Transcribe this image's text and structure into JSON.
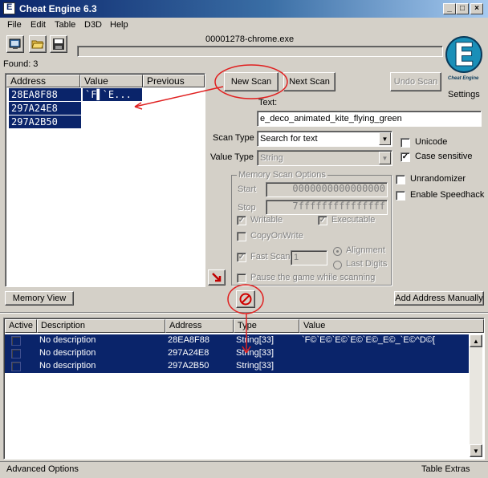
{
  "window": {
    "title": "Cheat Engine 6.3"
  },
  "menu": [
    "File",
    "Edit",
    "Table",
    "D3D",
    "Help"
  ],
  "process": {
    "name": "00001278-chrome.exe"
  },
  "found": {
    "label": "Found: 3"
  },
  "scan_results": {
    "columns": [
      "Address",
      "Value",
      "Previous"
    ],
    "rows": [
      {
        "address": "28EA8F88",
        "value": "`F▌`E..."
      },
      {
        "address": "297A24E8",
        "value": ""
      },
      {
        "address": "297A2B50",
        "value": ""
      }
    ]
  },
  "buttons": {
    "new_scan": "New Scan",
    "next_scan": "Next Scan",
    "undo_scan": "Undo Scan",
    "memory_view": "Memory View",
    "add_address": "Add Address Manually"
  },
  "settings": {
    "label": "Settings",
    "logo_text": "Cheat Engine"
  },
  "text_search": {
    "label": "Text:",
    "value": "e_deco_animated_kite_flying_green"
  },
  "scan_type": {
    "label": "Scan Type",
    "selected": "Search for text"
  },
  "value_type": {
    "label": "Value Type",
    "selected": "String"
  },
  "options": {
    "unicode": "Unicode",
    "case_sensitive": "Case sensitive",
    "unrandomizer": "Unrandomizer",
    "enable_speedhack": "Enable Speedhack"
  },
  "memory_options": {
    "title": "Memory Scan Options",
    "start_label": "Start",
    "start_value": "0000000000000000",
    "stop_label": "Stop",
    "stop_value": "7fffffffffffffff",
    "writable": "Writable",
    "executable": "Executable",
    "copy_on_write": "CopyOnWrite",
    "fast_scan": "Fast Scan",
    "fast_scan_value": "1",
    "alignment": "Alignment",
    "last_digits": "Last Digits",
    "pause": "Pause the game while scanning"
  },
  "address_table": {
    "columns": [
      "Active",
      "Description",
      "Address",
      "Type",
      "Value"
    ],
    "rows": [
      {
        "description": "No description",
        "address": "28EA8F88",
        "type": "String[33]",
        "value": "`F©`E©`E©`E©`E©_E©_`E©^D©["
      },
      {
        "description": "No description",
        "address": "297A24E8",
        "type": "String[33]",
        "value": ""
      },
      {
        "description": "No description",
        "address": "297A2B50",
        "type": "String[33]",
        "value": ""
      }
    ]
  },
  "status": {
    "left": "Advanced Options",
    "right": "Table Extras"
  },
  "colors": {
    "title_blue": "#0a246a",
    "selection": "#0a246a",
    "annotation_red": "#e02020",
    "face": "#d4d0c8"
  },
  "icons": [
    "open-process-icon",
    "open-file-icon",
    "save-icon",
    "cheat-engine-logo",
    "arrow-add-icon",
    "stop-scan-icon"
  ]
}
